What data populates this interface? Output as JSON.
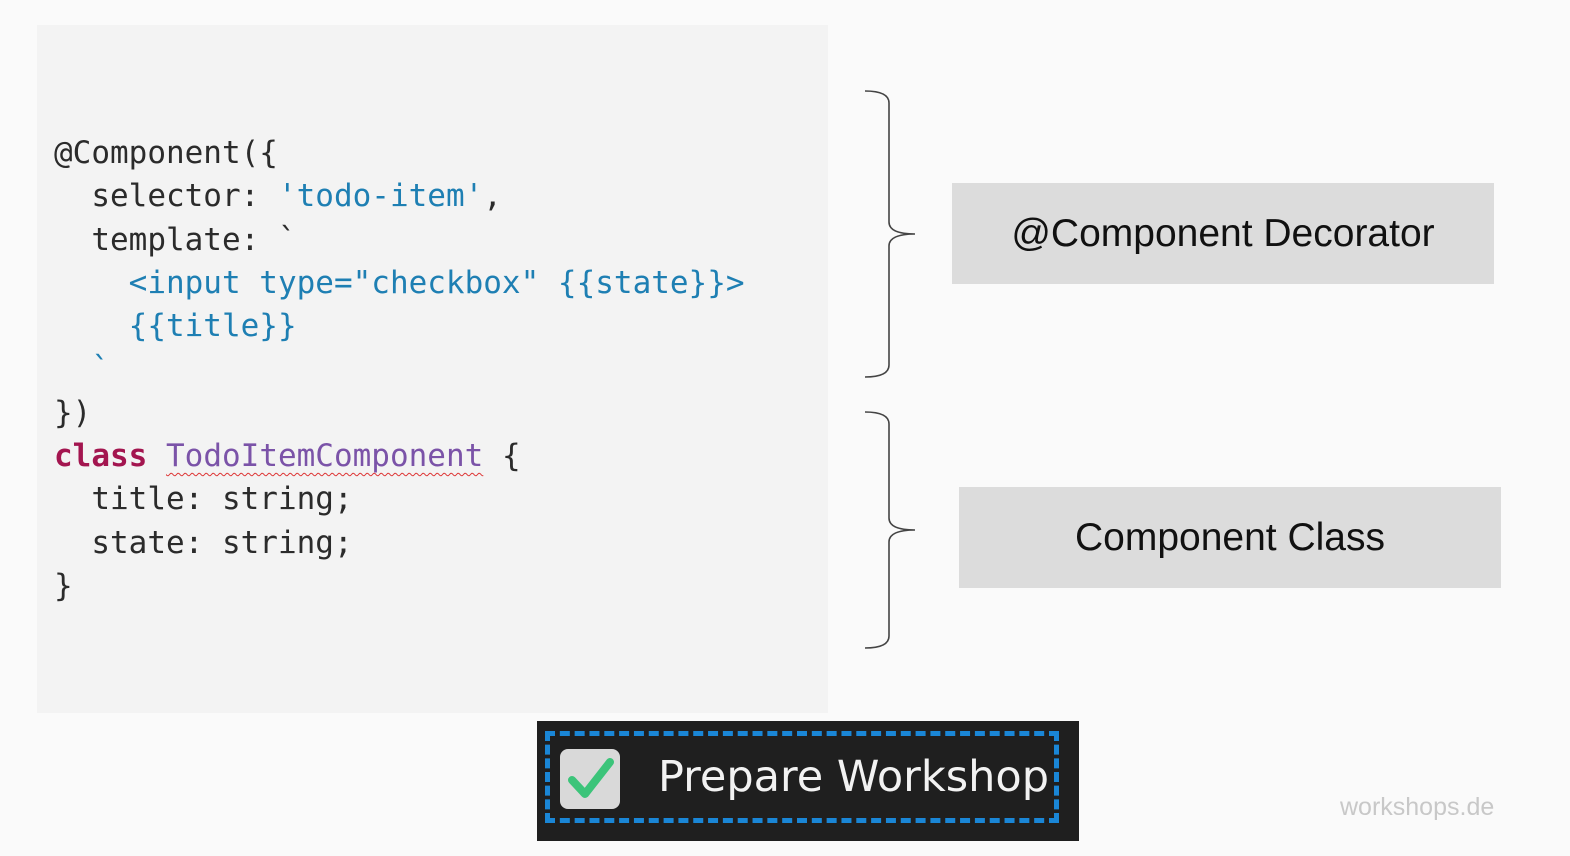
{
  "code": {
    "l1": "@Component({",
    "l2_key": "  selector: ",
    "l2_str": "'todo-item'",
    "l2_end": ",",
    "l3": "  template: `",
    "l4": "    <input type=\"checkbox\" {{state}}>",
    "l5": "    {{title}}",
    "l6": "  `",
    "l7": "})",
    "l8_kw": "class",
    "l8_cls": "TodoItemComponent",
    "l8_end": " {",
    "l9": "  title: string;",
    "l10": "  state: string;",
    "l11": "}"
  },
  "labels": {
    "decorator": "@Component Decorator",
    "class": "Component Class"
  },
  "demo": {
    "label": "Prepare Workshop",
    "checked": true,
    "check_icon": "check-icon"
  },
  "footer": "workshops.de",
  "colors": {
    "string": "#1e7fb3",
    "keyword": "#a3154f",
    "class_name": "#7b53a8",
    "dashed_border": "#1a86d6",
    "checkmark": "#3cc47a"
  }
}
